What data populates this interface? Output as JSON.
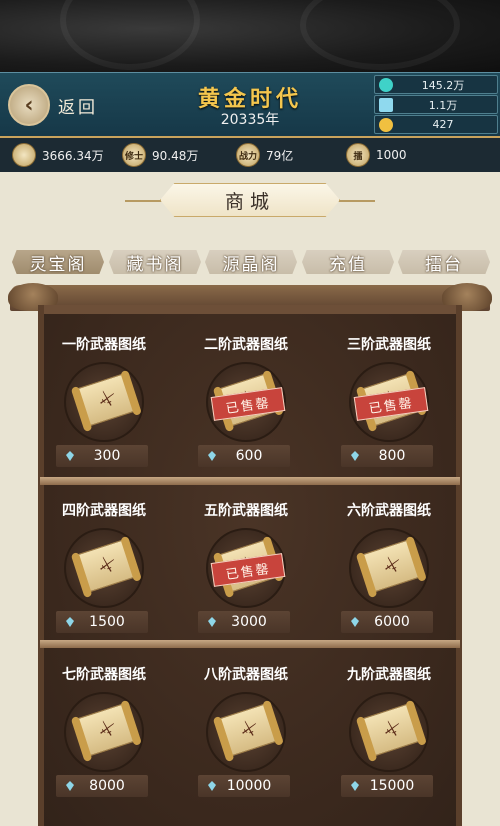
{
  "header": {
    "back_label": "返回",
    "era_title": "黄金时代",
    "era_year": "20335年"
  },
  "resources": [
    {
      "icon": "cyan-orb-icon",
      "value": "145.2万",
      "color": "#3fd2c8"
    },
    {
      "icon": "crystal-icon",
      "value": "1.1万",
      "color": "#8fd9ee"
    },
    {
      "icon": "gold-nugget-icon",
      "value": "427",
      "color": "#f0c040"
    }
  ],
  "stats": [
    {
      "icon": "people-icon",
      "icon_text": "",
      "value": "3666.34万"
    },
    {
      "icon": "cultivator-icon",
      "icon_text": "修士",
      "value": "90.48万"
    },
    {
      "icon": "strength-icon",
      "icon_text": "战力",
      "value": "79亿"
    },
    {
      "icon": "arena-icon",
      "icon_text": "擂",
      "value": "1000"
    }
  ],
  "shop": {
    "title": "商城",
    "tabs": [
      "灵宝阁",
      "藏书阁",
      "源晶阁",
      "充值",
      "擂台"
    ],
    "active_tab": 0,
    "sold_label": "已售罄",
    "items": [
      {
        "name": "一阶武器图纸",
        "price": "300",
        "sold_out": false
      },
      {
        "name": "二阶武器图纸",
        "price": "600",
        "sold_out": true
      },
      {
        "name": "三阶武器图纸",
        "price": "800",
        "sold_out": true
      },
      {
        "name": "四阶武器图纸",
        "price": "1500",
        "sold_out": false
      },
      {
        "name": "五阶武器图纸",
        "price": "3000",
        "sold_out": true
      },
      {
        "name": "六阶武器图纸",
        "price": "6000",
        "sold_out": false
      },
      {
        "name": "七阶武器图纸",
        "price": "8000",
        "sold_out": false
      },
      {
        "name": "八阶武器图纸",
        "price": "10000",
        "sold_out": false
      },
      {
        "name": "九阶武器图纸",
        "price": "15000",
        "sold_out": false
      }
    ]
  }
}
